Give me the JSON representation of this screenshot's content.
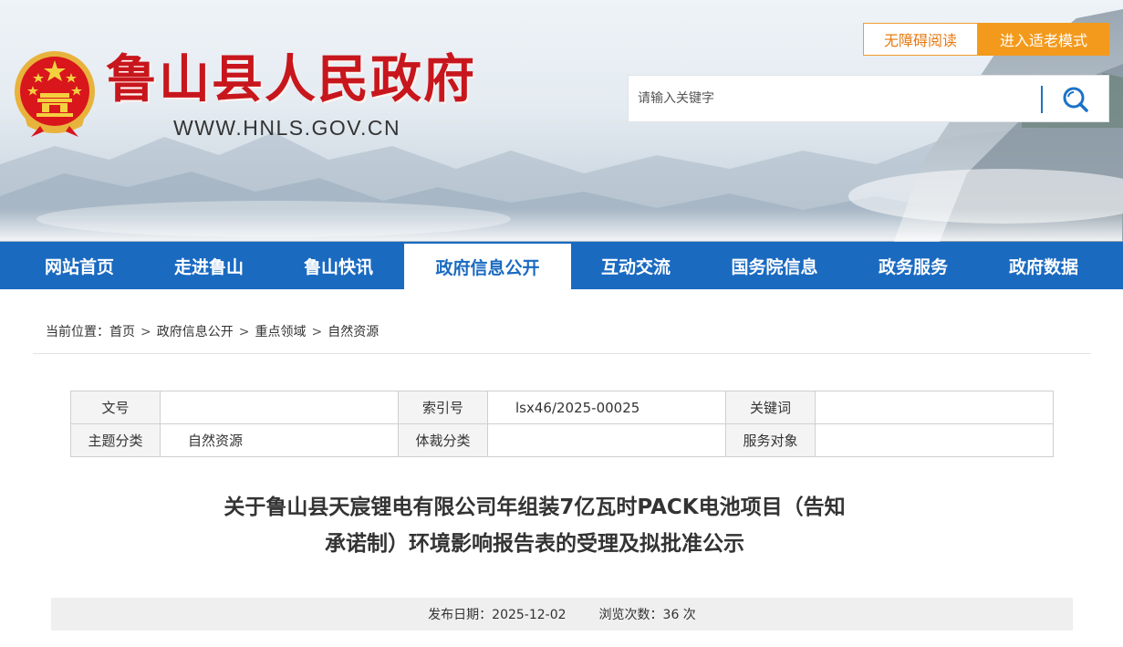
{
  "header": {
    "site_title": "鲁山县人民政府",
    "site_url": "WWW.HNLS.GOV.CN",
    "accessibility_label": "无障碍阅读",
    "elder_mode_label": "进入适老模式",
    "search_placeholder": "请输入关键字"
  },
  "nav": {
    "items": [
      {
        "label": "网站首页"
      },
      {
        "label": "走进鲁山"
      },
      {
        "label": "鲁山快讯"
      },
      {
        "label": "政府信息公开"
      },
      {
        "label": "互动交流"
      },
      {
        "label": "国务院信息"
      },
      {
        "label": "政务服务"
      },
      {
        "label": "政府数据"
      }
    ],
    "active_index": 3
  },
  "breadcrumb": {
    "prefix": "当前位置：",
    "items": [
      "首页",
      "政府信息公开",
      "重点领域",
      "自然资源"
    ],
    "separator": ">"
  },
  "meta_table": {
    "rows": [
      [
        {
          "label": "文号",
          "value": ""
        },
        {
          "label": "索引号",
          "value": "lsx46/2025-00025"
        },
        {
          "label": "关键词",
          "value": ""
        }
      ],
      [
        {
          "label": "主题分类",
          "value": "自然资源"
        },
        {
          "label": "体裁分类",
          "value": ""
        },
        {
          "label": "服务对象",
          "value": ""
        }
      ]
    ]
  },
  "article": {
    "title_line1": "关于鲁山县天宸锂电有限公司年组装7亿瓦时PACK电池项目（告知",
    "title_line2": "承诺制）环境影响报告表的受理及拟批准公示",
    "publish_date": "发布日期：2025-12-02",
    "views": "浏览次数：36 次"
  },
  "colors": {
    "brand_red": "#c8161d",
    "nav_blue": "#1a6ac0",
    "accent_orange": "#f39a1c"
  }
}
